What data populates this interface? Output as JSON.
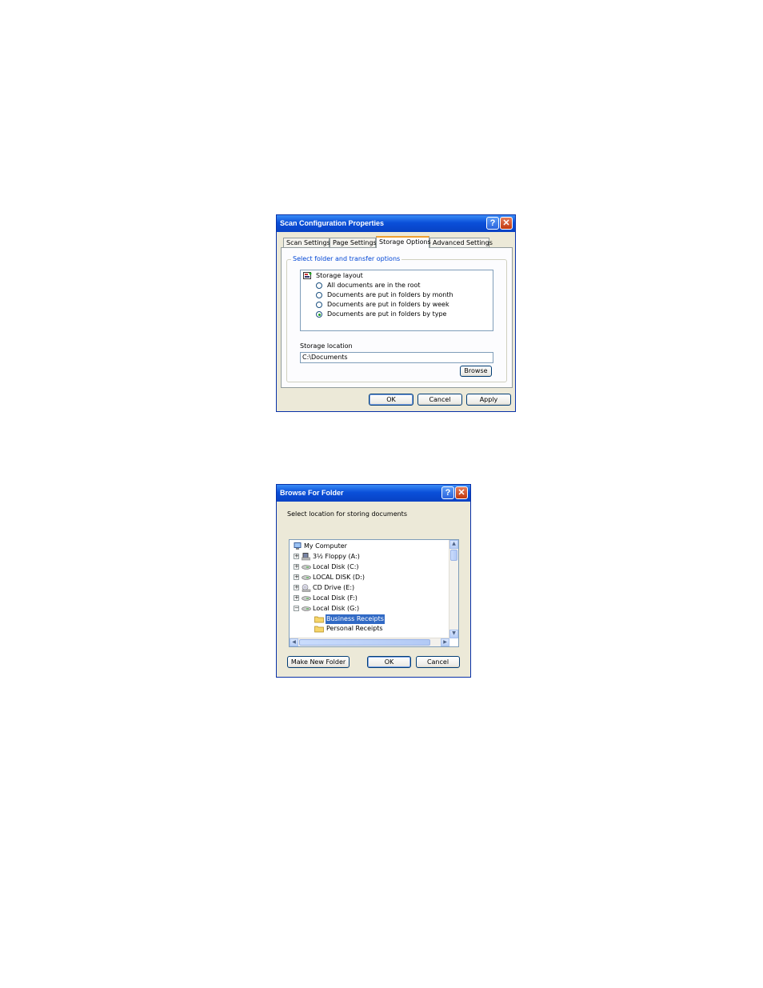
{
  "scan_dialog": {
    "title": "Scan Configuration Properties",
    "help_glyph": "?",
    "close_glyph": "✕",
    "tabs": [
      {
        "label": "Scan Settings"
      },
      {
        "label": "Page Settings"
      },
      {
        "label": "Storage Options",
        "active": true
      },
      {
        "label": "Advanced Settings"
      }
    ],
    "group_label": "Select folder and transfer options",
    "layout_header": "Storage layout",
    "layout_options": [
      {
        "label": "All documents are in the root",
        "selected": false
      },
      {
        "label": "Documents are put in folders by month",
        "selected": false
      },
      {
        "label": "Documents are put in folders by week",
        "selected": false
      },
      {
        "label": "Documents are put in folders by type",
        "selected": true
      }
    ],
    "storage_location_label": "Storage location",
    "storage_location_value": "C:\\Documents",
    "browse_label": "Browse",
    "ok_label": "OK",
    "cancel_label": "Cancel",
    "apply_label": "Apply"
  },
  "browse_dialog": {
    "title": "Browse For Folder",
    "help_glyph": "?",
    "close_glyph": "✕",
    "instruction": "Select location for storing documents",
    "tree": [
      {
        "label": "My Computer",
        "icon": "computer-icon",
        "expander": ""
      },
      {
        "label": "3½ Floppy (A:)",
        "icon": "floppy-drive-icon",
        "expander": "+"
      },
      {
        "label": "Local Disk (C:)",
        "icon": "hard-drive-icon",
        "expander": "+"
      },
      {
        "label": "LOCAL DISK (D:)",
        "icon": "hard-drive-icon",
        "expander": "+"
      },
      {
        "label": "CD Drive (E:)",
        "icon": "cd-drive-icon",
        "expander": "+"
      },
      {
        "label": "Local Disk (F:)",
        "icon": "hard-drive-icon",
        "expander": "+"
      },
      {
        "label": "Local Disk (G:)",
        "icon": "hard-drive-icon",
        "expander": "−"
      },
      {
        "label": "Business Receipts",
        "icon": "folder-icon",
        "expander": "",
        "selected": true
      },
      {
        "label": "Personal Receipts",
        "icon": "folder-icon",
        "expander": ""
      }
    ],
    "make_new_folder_label": "Make New Folder",
    "ok_label": "OK",
    "cancel_label": "Cancel"
  },
  "colors": {
    "titlebar": "#0a4fd9",
    "dialog_face": "#ece9d8",
    "selection": "#316ac5",
    "group_label": "#0046d5"
  }
}
